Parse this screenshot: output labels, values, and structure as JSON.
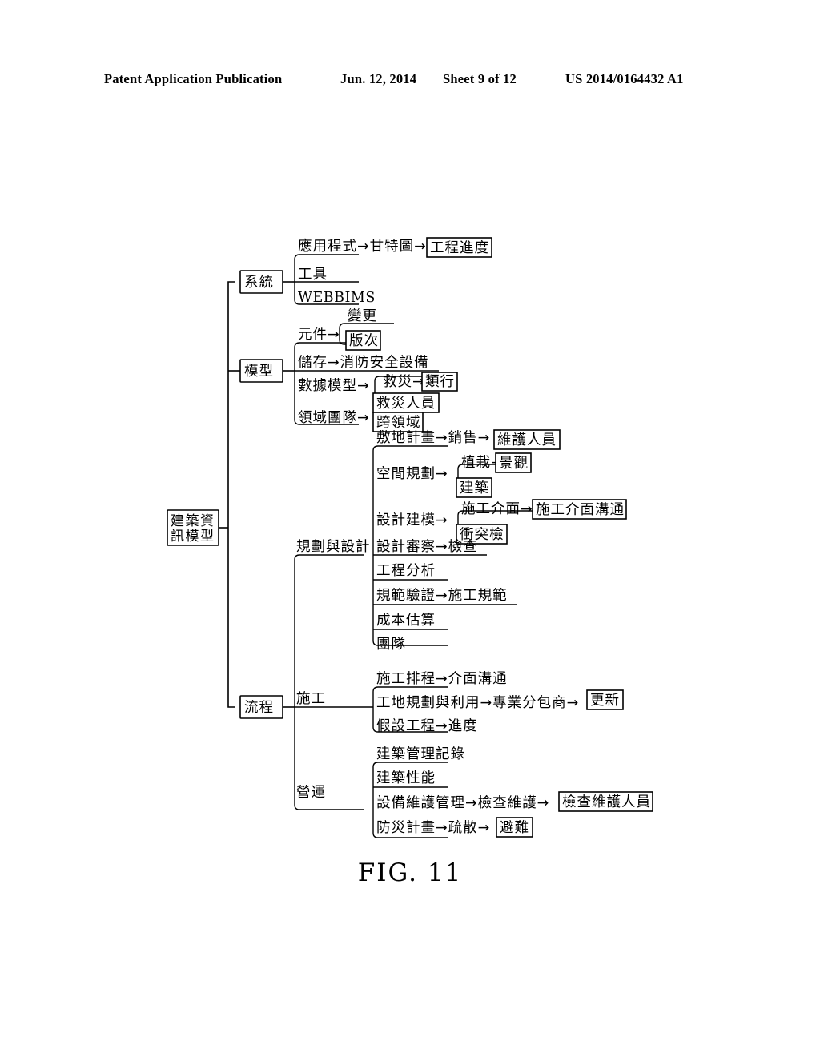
{
  "header": {
    "publication": "Patent Application Publication",
    "date": "Jun. 12, 2014",
    "sheet": "Sheet 9 of 12",
    "patent_number": "US 2014/0164432 A1"
  },
  "figure": {
    "caption": "FIG. 11"
  },
  "diagram": {
    "type": "tree",
    "root": "建築資\n訊模型",
    "root_line1": "建築資",
    "root_line2": "訊模型",
    "branch_system": "系統",
    "branch_model": "模型",
    "branch_process": "流程",
    "system_items": {
      "item1_a": "應用程式→甘特圖→",
      "item1_b": "工程進度",
      "item2": "工具",
      "item3": "WEBBIMS"
    },
    "model_items": {
      "component_label": "元件→",
      "component_top": "變更",
      "component_bottom": "版次",
      "storage": "儲存→消防安全設備",
      "datamodel_label": "數據模型→",
      "datamodel_top_a": "救災→",
      "datamodel_top_b": "類行",
      "datamodel_bottom": "救災人員",
      "domain_label": "領域團隊→",
      "domain_box": "跨領域"
    },
    "process_groups": {
      "design": "規劃與設計",
      "construction": "施工",
      "operation": "營運"
    },
    "design_items": {
      "site_a": "敷地計畫→銷售→",
      "site_b": "維護人員",
      "space_label": "空間規劃→",
      "space_top_a": "植栽→",
      "space_top_b": "景觀",
      "space_bottom": "建築",
      "modeling_label": "設計建模→",
      "modeling_top_a": "施工介面→",
      "modeling_top_b": "施工介面溝通",
      "modeling_bottom": "衝突檢",
      "review": "設計審察→檢查",
      "analysis": "工程分析",
      "code": "規範驗證→施工規範",
      "cost": "成本估算",
      "team": "團隊"
    },
    "construction_items": {
      "schedule": "施工排程→介面溝通",
      "site_a": "工地規劃與利用→專業分包商→",
      "site_b": "更新",
      "temp": "假設工程→進度"
    },
    "operation_items": {
      "record": "建築管理記錄",
      "performance": "建築性能",
      "maintenance_a": "設備維護管理→檢查維護→",
      "maintenance_b": "檢查維護人員",
      "disaster_a": "防災計畫→疏散→",
      "disaster_b": "避難"
    }
  }
}
